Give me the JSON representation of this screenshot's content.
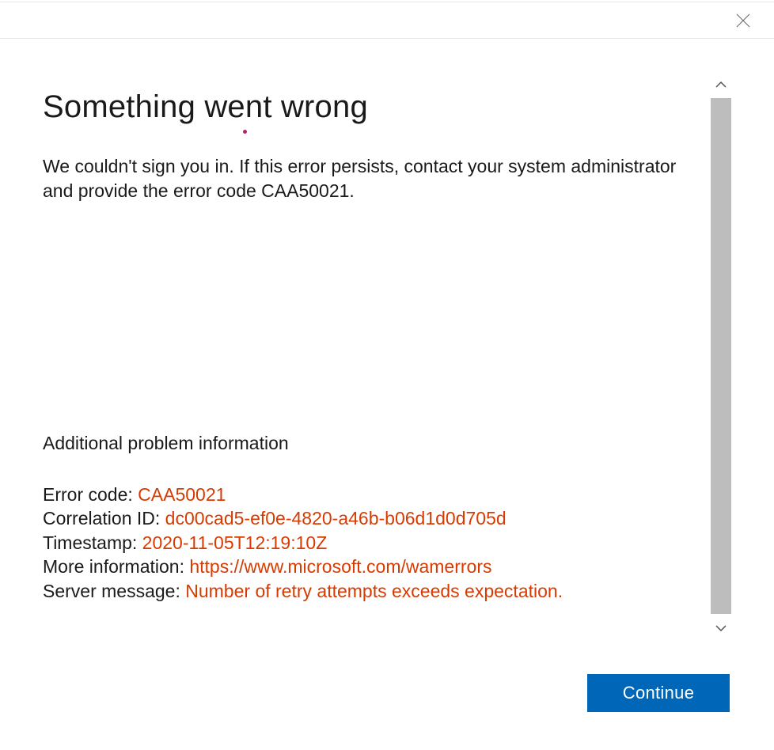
{
  "dialog": {
    "title": "Something went wrong",
    "description": "We couldn't sign you in. If this error persists, contact your system administrator and provide the error code CAA50021.",
    "additional_heading": "Additional problem information",
    "details": {
      "error_code_label": "Error code: ",
      "error_code_value": "CAA50021",
      "correlation_id_label": "Correlation ID: ",
      "correlation_id_value": "dc00cad5-ef0e-4820-a46b-b06d1d0d705d",
      "timestamp_label": "Timestamp: ",
      "timestamp_value": "2020-11-05T12:19:10Z",
      "more_info_label": "More information: ",
      "more_info_value": "https://www.microsoft.com/wamerrors",
      "server_message_label": "Server message: ",
      "server_message_value": "Number of retry attempts exceeds expectation."
    },
    "continue_label": "Continue"
  }
}
